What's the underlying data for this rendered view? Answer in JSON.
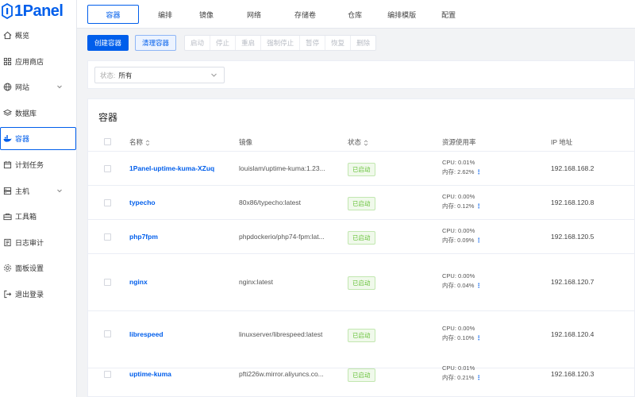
{
  "app": {
    "logo_text": "1Panel",
    "accent": "#005eeb"
  },
  "sidebar": {
    "items": [
      {
        "label": "概览",
        "icon": "home-icon"
      },
      {
        "label": "应用商店",
        "icon": "grid-icon"
      },
      {
        "label": "网站",
        "icon": "globe-icon",
        "expandable": true
      },
      {
        "label": "数据库",
        "icon": "layers-icon"
      },
      {
        "label": "容器",
        "icon": "docker-icon",
        "active": true
      },
      {
        "label": "计划任务",
        "icon": "calendar-icon"
      },
      {
        "label": "主机",
        "icon": "server-icon",
        "expandable": true
      },
      {
        "label": "工具箱",
        "icon": "toolbox-icon"
      },
      {
        "label": "日志审计",
        "icon": "log-icon"
      },
      {
        "label": "面板设置",
        "icon": "gear-icon"
      },
      {
        "label": "退出登录",
        "icon": "logout-icon"
      }
    ]
  },
  "tabs": [
    "容器",
    "编排",
    "镜像",
    "网络",
    "存储卷",
    "仓库",
    "编排模版",
    "配置"
  ],
  "toolbar": {
    "create_label": "创建容器",
    "clean_label": "清理容器",
    "group": [
      "启动",
      "停止",
      "重启",
      "强制停止",
      "暂停",
      "恢复",
      "删除"
    ]
  },
  "filter": {
    "label": "状态:",
    "value": "所有"
  },
  "panel": {
    "title": "容器"
  },
  "table": {
    "headers": {
      "name": "名称",
      "image": "镜像",
      "status": "状态",
      "resource": "资源使用率",
      "ip": "IP 地址"
    },
    "rows": [
      {
        "name": "1Panel-uptime-kuma-XZuq",
        "image": "louislam/uptime-kuma:1.23...",
        "status": "已启动",
        "cpu": "CPU: 0.01%",
        "mem": "内存: 2.62%",
        "ip": "192.168.168.2"
      },
      {
        "name": "typecho",
        "image": "80x86/typecho:latest",
        "status": "已启动",
        "cpu": "CPU: 0.00%",
        "mem": "内存: 0.12%",
        "ip": "192.168.120.8"
      },
      {
        "name": "php7fpm",
        "image": "phpdockerio/php74-fpm:lat...",
        "status": "已启动",
        "cpu": "CPU: 0.00%",
        "mem": "内存: 0.09%",
        "ip": "192.168.120.5"
      },
      {
        "name": "nginx",
        "image": "nginx:latest",
        "status": "已启动",
        "cpu": "CPU: 0.00%",
        "mem": "内存: 0.04%",
        "ip": "192.168.120.7"
      },
      {
        "name": "librespeed",
        "image": "linuxserver/librespeed:latest",
        "status": "已启动",
        "cpu": "CPU: 0.00%",
        "mem": "内存: 0.10%",
        "ip": "192.168.120.4"
      },
      {
        "name": "uptime-kuma",
        "image": "pfti226w.mirror.aliyuncs.co...",
        "status": "已启动",
        "cpu": "CPU: 0.01%",
        "mem": "内存: 0.21%",
        "ip": "192.168.120.3"
      }
    ]
  }
}
